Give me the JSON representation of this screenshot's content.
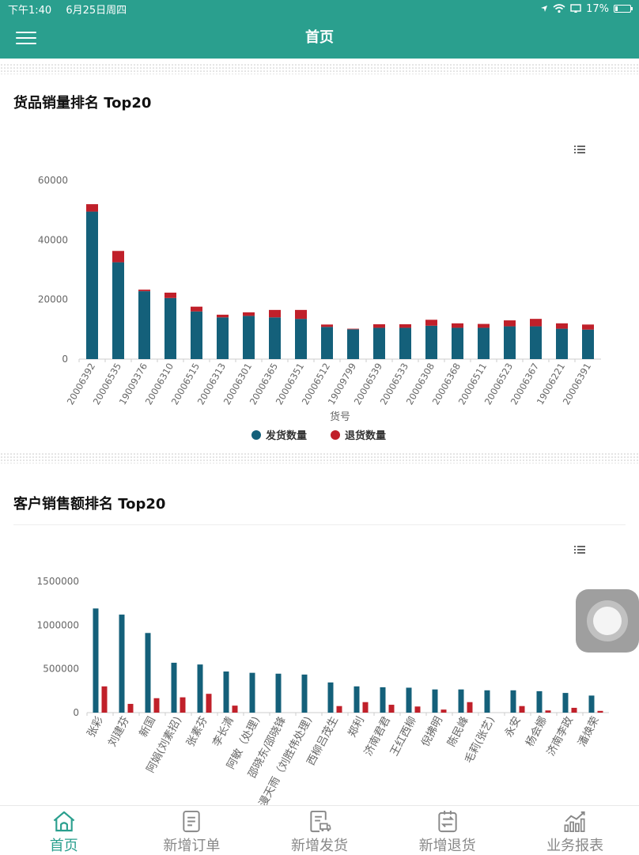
{
  "status_bar": {
    "time": "下午1:40",
    "date": "6月25日周四",
    "battery": "17%",
    "battery_level": 0.17
  },
  "nav": {
    "title": "首页",
    "menu_icon": "hamburger-icon"
  },
  "colors": {
    "primary": "#2a9f8e",
    "ship": "#14607a",
    "return": "#c0202a"
  },
  "chart1": {
    "section_title": "货品销量排名 Top20",
    "chart_data": {
      "type": "bar",
      "stacked": true,
      "categories": [
        "20006392",
        "20006535",
        "19009376",
        "20006310",
        "20006515",
        "20006313",
        "20006301",
        "20006365",
        "20006351",
        "20006512",
        "19009799",
        "20006539",
        "20006533",
        "20006308",
        "20006368",
        "20006511",
        "20006523",
        "20006367",
        "19006221",
        "20006391"
      ],
      "series": [
        {
          "name": "发货数量",
          "values": [
            49500,
            32500,
            22800,
            20500,
            16000,
            14000,
            14500,
            14000,
            13500,
            10800,
            10000,
            10500,
            10500,
            11200,
            10500,
            10500,
            11000,
            11000,
            10200,
            9900
          ],
          "color": "#14607a"
        },
        {
          "name": "退货数量",
          "values": [
            2500,
            3800,
            500,
            1800,
            1600,
            900,
            1200,
            2500,
            3000,
            800,
            200,
            1200,
            1200,
            2000,
            1500,
            1300,
            2000,
            2500,
            1800,
            1700
          ],
          "color": "#c0202a"
        }
      ],
      "yticks": [
        "0",
        "20000",
        "40000",
        "60000"
      ],
      "ylim": [
        0,
        60000
      ],
      "xlabel": "货号",
      "ylabel": "",
      "legend_position": "bottom",
      "grid": false
    }
  },
  "chart2": {
    "section_title": "客户销售额排名 Top20",
    "chart_data": {
      "type": "bar",
      "stacked": false,
      "categories": [
        "张彩",
        "刘建芬",
        "新国",
        "阿娟(刘素招)",
        "张素芬",
        "李长清",
        "阿敏（处理)",
        "邵晓东/邵晓锋",
        "漫天雨（刘胜伟处理)",
        "西柳吕茂生",
        "郑利",
        "济南君君",
        "王红西柳",
        "倪拂明",
        "陈民峰",
        "毛莉(张艺)",
        "永安",
        "杨会娜",
        "济南李政",
        "潘焕荣"
      ],
      "series": [
        {
          "name": "发货数量",
          "values": [
            1190000,
            1120000,
            910000,
            570000,
            550000,
            470000,
            455000,
            445000,
            435000,
            345000,
            300000,
            290000,
            285000,
            265000,
            265000,
            255000,
            255000,
            245000,
            225000,
            195000
          ],
          "color": "#14607a"
        },
        {
          "name": "退货数量",
          "values": [
            300000,
            100000,
            165000,
            175000,
            215000,
            80000,
            0,
            0,
            0,
            75000,
            120000,
            90000,
            70000,
            35000,
            120000,
            0,
            75000,
            25000,
            55000,
            20000
          ],
          "color": "#c0202a"
        }
      ],
      "yticks": [
        "0",
        "500000",
        "1000000",
        "1500000"
      ],
      "ylim": [
        0,
        1500000
      ],
      "xlabel": "",
      "ylabel": "",
      "grid": false
    }
  },
  "tabs": [
    {
      "label": "首页",
      "icon": "home-icon",
      "active": true
    },
    {
      "label": "新增订单",
      "icon": "order-icon",
      "active": false
    },
    {
      "label": "新增发货",
      "icon": "shipping-doc-icon",
      "active": false
    },
    {
      "label": "新增退货",
      "icon": "return-exchange-icon",
      "active": false
    },
    {
      "label": "业务报表",
      "icon": "report-chart-icon",
      "active": false
    }
  ]
}
